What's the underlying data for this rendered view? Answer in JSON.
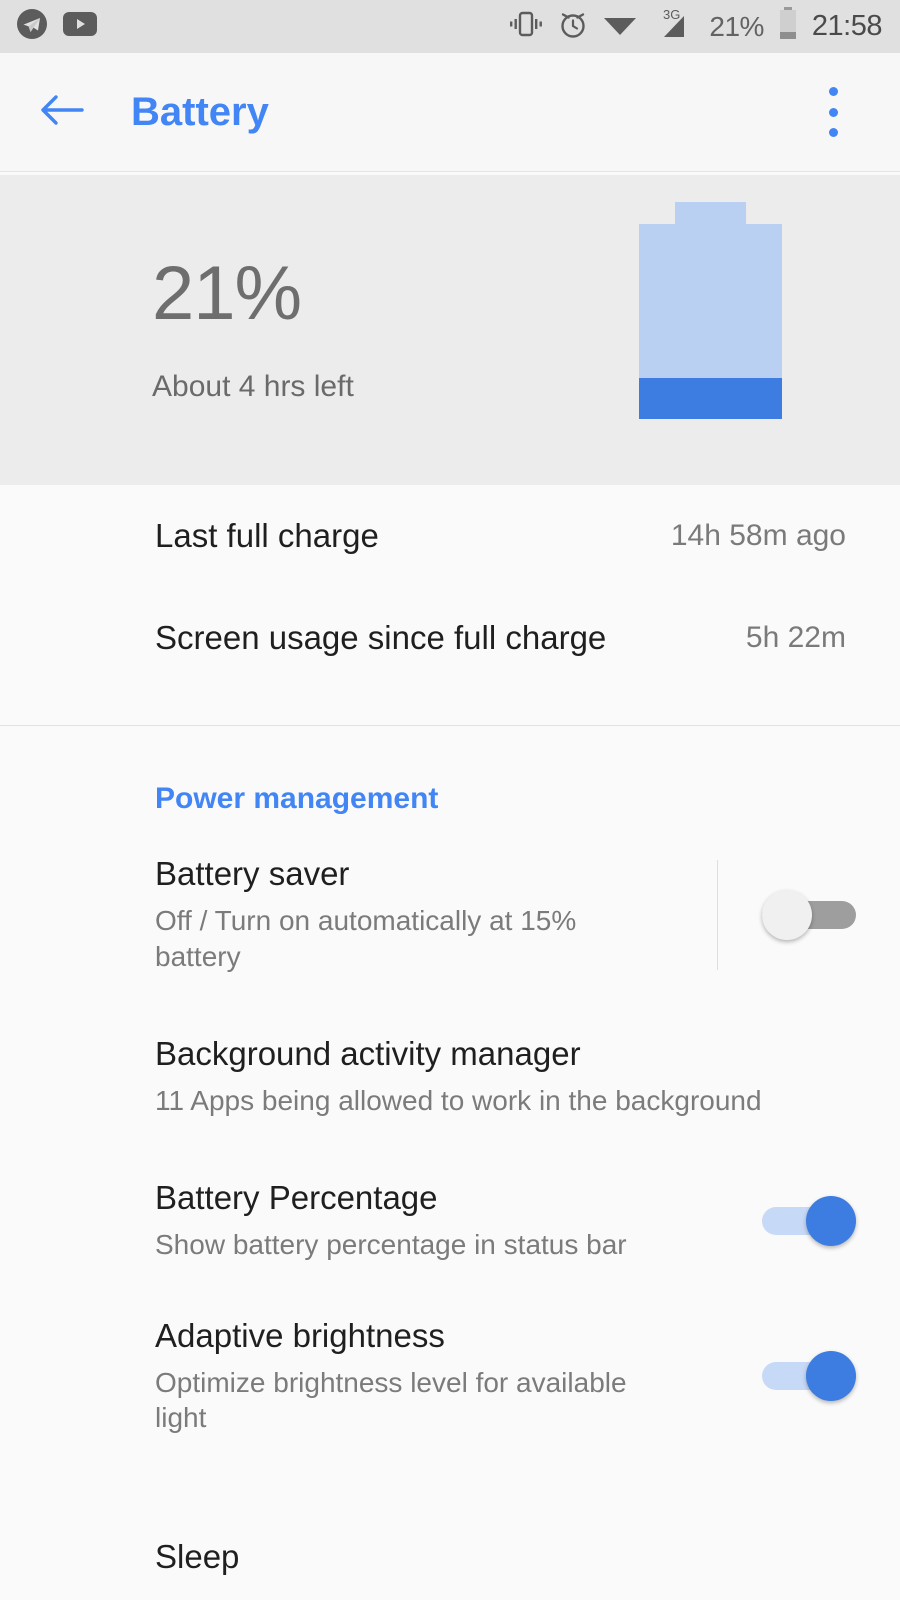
{
  "status_bar": {
    "notification_icons": [
      "telegram-icon",
      "youtube-icon"
    ],
    "system_icons": [
      "vibrate-icon",
      "alarm-icon",
      "wifi-icon",
      "signal-3g-icon"
    ],
    "network_type": "3G",
    "battery_percent": "21%",
    "time": "21:58"
  },
  "app_bar": {
    "back_icon": "back-arrow-icon",
    "title": "Battery",
    "overflow_icon": "more-vertical-icon"
  },
  "summary": {
    "percent": "21%",
    "time_remaining": "About 4 hrs left",
    "battery_level_fraction": 0.21,
    "battery_body_color": "#b9d0f2",
    "battery_fill_color": "#3d7ce0"
  },
  "info_rows": [
    {
      "label": "Last full charge",
      "value": "14h 58m ago"
    },
    {
      "label": "Screen usage since full charge",
      "value": "5h 22m"
    }
  ],
  "power_management": {
    "header": "Power management",
    "accent_color": "#4285f4",
    "items": [
      {
        "title": "Battery saver",
        "subtitle": "Off / Turn on automatically at 15% battery",
        "toggle": "off"
      },
      {
        "title": "Background activity manager",
        "subtitle": "11 Apps being allowed to work in the background"
      },
      {
        "title": "Battery Percentage",
        "subtitle": "Show battery percentage in status bar",
        "toggle": "on"
      },
      {
        "title": "Adaptive brightness",
        "subtitle": "Optimize brightness level for available light",
        "toggle": "on"
      },
      {
        "title": "Sleep"
      }
    ]
  }
}
